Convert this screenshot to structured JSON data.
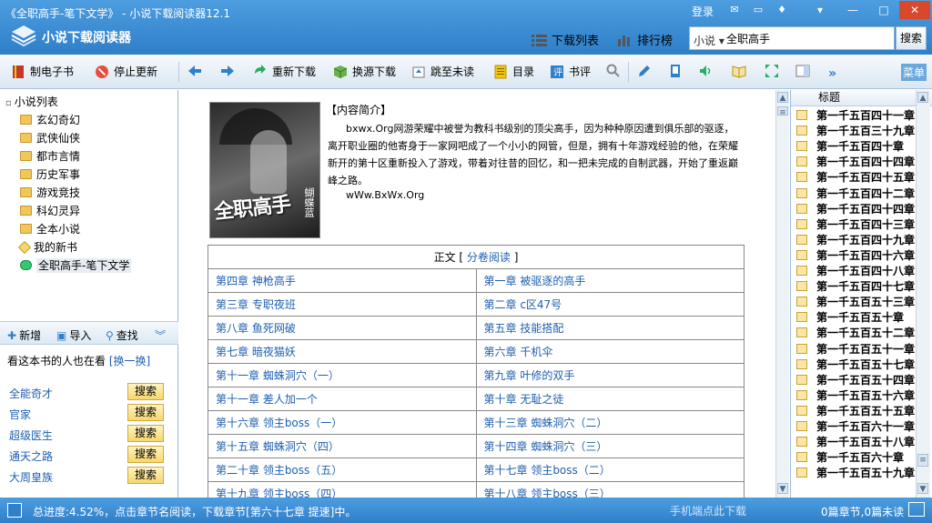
{
  "window": {
    "title": "《全职高手-笔下文学》 - 小说下载阅读器12.1",
    "app_name": "小说下载阅读器",
    "login": "登录",
    "controls": [
      "mail-icon",
      "chat-icon",
      "shirt-icon",
      "menu-icon",
      "minimize-icon",
      "maximize-icon",
      "close-icon"
    ]
  },
  "header": {
    "download_list": "下载列表",
    "ranking": "排行榜",
    "search_scope": "小说",
    "search_value": "全职高手",
    "search_button": "搜索"
  },
  "toolbar": {
    "make_ebook": "制电子书",
    "stop_update": "停止更新",
    "redownload": "重新下载",
    "switch_source": "换源下载",
    "jump_unread": "跳至未读",
    "toc": "目录",
    "review": "书评",
    "menu": "菜单"
  },
  "sidebar": {
    "root": "小说列表",
    "items": [
      "玄幻奇幻",
      "武侠仙侠",
      "都市言情",
      "历史军事",
      "游戏竞技",
      "科幻灵异",
      "全本小说",
      "我的新书",
      "全职高手-笔下文学"
    ],
    "actions": {
      "add": "新增",
      "import": "导入",
      "find": "查找"
    },
    "recommend_title": "看这本书的人也在看",
    "recommend_switch": "[换一换]",
    "recommend": [
      {
        "title": "全能奇才",
        "button": "搜索"
      },
      {
        "title": "官家",
        "button": "搜索"
      },
      {
        "title": "超级医生",
        "button": "搜索"
      },
      {
        "title": "通天之路",
        "button": "搜索"
      },
      {
        "title": "大周皇族",
        "button": "搜索"
      }
    ]
  },
  "book": {
    "cover_title": "全职高手",
    "cover_author": "蝴蝶蓝",
    "intro_label": "【内容简介】",
    "intro": "bxwx.Org网游荣耀中被誉为教科书级别的顶尖高手，因为种种原因遭到俱乐部的驱逐，离开职业圈的他寄身于一家网吧成了一个小小的网管，但是，拥有十年游戏经验的他，在荣耀新开的第十区重新投入了游戏，带着对往昔的回忆，和一把未完成的自制武器，开始了重返巅峰之路。",
    "url": "wWw.BxWx.Org",
    "toc_head": "正文 [",
    "toc_head_link": "分卷阅读",
    "toc_head_end": "]",
    "chapters": [
      [
        "第四章 神枪高手",
        "第一章 被驱逐的高手"
      ],
      [
        "第三章 专职夜班",
        "第二章 c区47号"
      ],
      [
        "第八章 鱼死网破",
        "第五章 技能搭配"
      ],
      [
        "第七章 暗夜猫妖",
        "第六章 千机伞"
      ],
      [
        "第十一章 蜘蛛洞穴（一）",
        "第九章 叶修的双手"
      ],
      [
        "第十一章 差人加一个",
        "第十章 无耻之徒"
      ],
      [
        "第十六章 领主boss（一）",
        "第十三章 蜘蛛洞穴（二）"
      ],
      [
        "第十五章 蜘蛛洞穴（四）",
        "第十四章 蜘蛛洞穴（三）"
      ],
      [
        "第二十章 领主boss（五）",
        "第十七章 领主boss（二）"
      ],
      [
        "第十九章 领主boss（四）",
        "第十八章 领主boss（三）"
      ]
    ]
  },
  "chapter_list": {
    "header": "标题",
    "items": [
      "第一千五百四十一章",
      "第一千五百三十九章",
      "第一千五百四十章",
      "第一千五百四十四章",
      "第一千五百四十五章",
      "第一千五百四十二章",
      "第一千五百四十四章",
      "第一千五百四十三章",
      "第一千五百四十九章",
      "第一千五百四十六章",
      "第一千五百四十八章",
      "第一千五百四十七章",
      "第一千五百五十三章",
      "第一千五百五十章",
      "第一千五百五十二章",
      "第一千五百五十一章",
      "第一千五百五十七章",
      "第一千五百五十四章",
      "第一千五百五十六章",
      "第一千五百五十五章",
      "第一千五百六十一章",
      "第一千五百五十八章",
      "第一千五百六十章",
      "第一千五百五十九章"
    ]
  },
  "status": {
    "progress_text": "总进度:4.52%，点击章节名阅读，下载章节[第六十七章 提速]中。",
    "mobile_link": "手机端点此下载",
    "counts": "0篇章节,0篇未读"
  }
}
